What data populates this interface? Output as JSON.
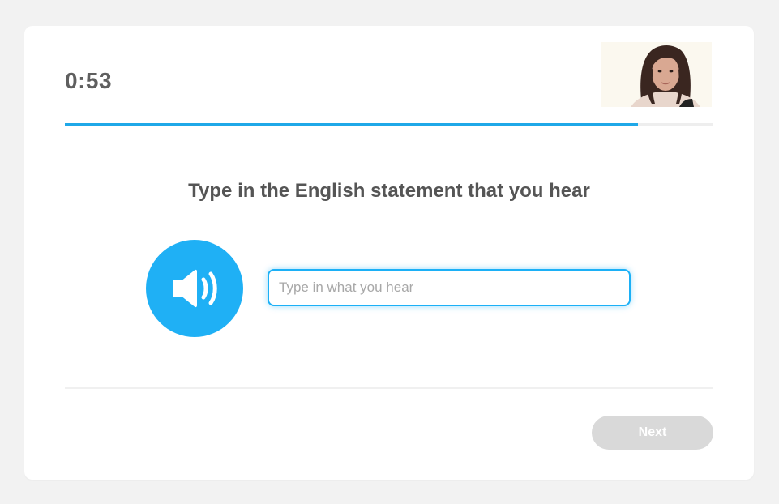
{
  "timer": {
    "value": "0:53"
  },
  "progress": {
    "fraction": 0.884,
    "color": "#1fa8e8"
  },
  "question": {
    "prompt": "Type in the English statement that you hear"
  },
  "audio": {
    "icon": "speaker-icon",
    "color": "#1fb0f5"
  },
  "answer": {
    "value": "",
    "placeholder": "Type in what you hear"
  },
  "footer": {
    "next_label": "Next"
  }
}
